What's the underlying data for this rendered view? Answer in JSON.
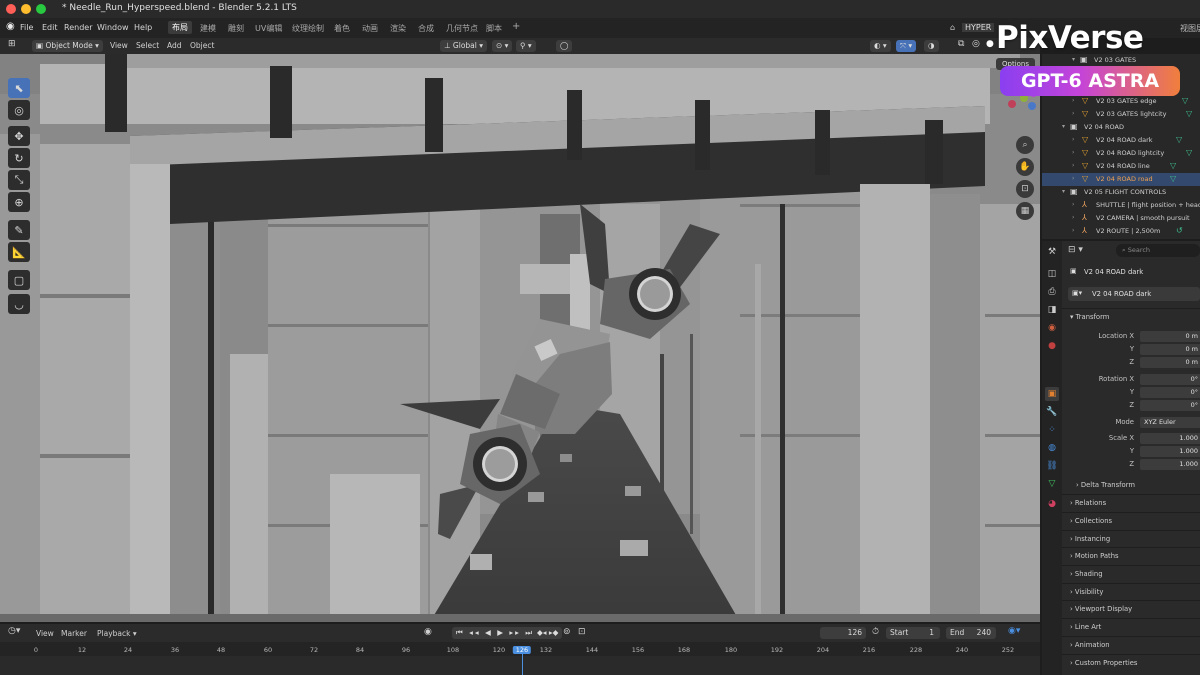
{
  "window": {
    "title": "* Needle_Run_Hyperspeed.blend - Blender 5.2.1 LTS"
  },
  "menu": {
    "items": [
      "File",
      "Edit",
      "Render",
      "Window",
      "Help"
    ],
    "workspaces": [
      "布局",
      "建模",
      "雕刻",
      "UV编辑",
      "纹理绘制",
      "着色",
      "动画",
      "渲染",
      "合成",
      "几何节点",
      "脚本"
    ],
    "active_workspace": "布局",
    "add_tab": "+",
    "scene_field": "HYPER",
    "right_tab": "视图层"
  },
  "viewport_header": {
    "mode": "Object Mode",
    "view": "View",
    "select": "Select",
    "add": "Add",
    "object": "Object",
    "orientation": "Global",
    "options": "Options"
  },
  "outliner": {
    "rows": [
      {
        "label": "V2 03 GATES",
        "indent": 1,
        "type": "collection"
      },
      {
        "label": "V2 03 GATES edge",
        "indent": 2,
        "type": "mesh"
      },
      {
        "label": "V2 03 GATES lightcity",
        "indent": 2,
        "type": "mesh"
      },
      {
        "label": "V2 04 ROAD",
        "indent": 1,
        "type": "collection"
      },
      {
        "label": "V2 04 ROAD dark",
        "indent": 2,
        "type": "mesh"
      },
      {
        "label": "V2 04 ROAD lightcity",
        "indent": 2,
        "type": "mesh"
      },
      {
        "label": "V2 04 ROAD line",
        "indent": 2,
        "type": "mesh"
      },
      {
        "label": "V2 04 ROAD road",
        "indent": 2,
        "type": "mesh",
        "selected": true
      },
      {
        "label": "V2 05 FLIGHT CONTROLS",
        "indent": 1,
        "type": "collection"
      },
      {
        "label": "SHUTTLE | flight position + heading",
        "indent": 2,
        "type": "empty"
      },
      {
        "label": "V2 CAMERA | smooth pursuit",
        "indent": 2,
        "type": "empty"
      },
      {
        "label": "V2 ROUTE | 2,500m",
        "indent": 2,
        "type": "empty"
      }
    ]
  },
  "properties": {
    "search_placeholder": "Search",
    "object_name": "V2 04 ROAD dark",
    "data_name": "V2 04 ROAD dark",
    "transform_label": "Transform",
    "location_label": "Location X",
    "rotation_label": "Rotation X",
    "scale_label": "Scale X",
    "axis_y": "Y",
    "axis_z": "Z",
    "location": [
      "0 m",
      "0 m",
      "0 m"
    ],
    "rotation": [
      "0°",
      "0°",
      "0°"
    ],
    "mode_label": "Mode",
    "mode_value": "XYZ Euler",
    "scale": [
      "1.000",
      "1.000",
      "1.000"
    ],
    "panels": [
      "Delta Transform",
      "Relations",
      "Collections",
      "Instancing",
      "Motion Paths",
      "Shading",
      "Visibility",
      "Viewport Display",
      "Line Art",
      "Animation",
      "Custom Properties"
    ]
  },
  "timeline": {
    "view": "View",
    "marker": "Marker",
    "playback": "Playback",
    "current_frame": "126",
    "start_label": "Start",
    "start": "1",
    "end_label": "End",
    "end": "240",
    "ticks": [
      "0",
      "12",
      "24",
      "36",
      "48",
      "60",
      "72",
      "84",
      "96",
      "108",
      "120",
      "126",
      "132",
      "144",
      "156",
      "168",
      "180",
      "192",
      "204",
      "216",
      "228",
      "240",
      "252"
    ]
  },
  "watermark": {
    "brand": "PixVerse",
    "badge": "GPT-6 ASTRA"
  },
  "colors": {
    "accent": "#4872b8",
    "selection": "#334a6e",
    "playhead": "#4a8fe0",
    "mesh_icon": "#e0a030",
    "collection_icon": "#d0d0d0"
  }
}
